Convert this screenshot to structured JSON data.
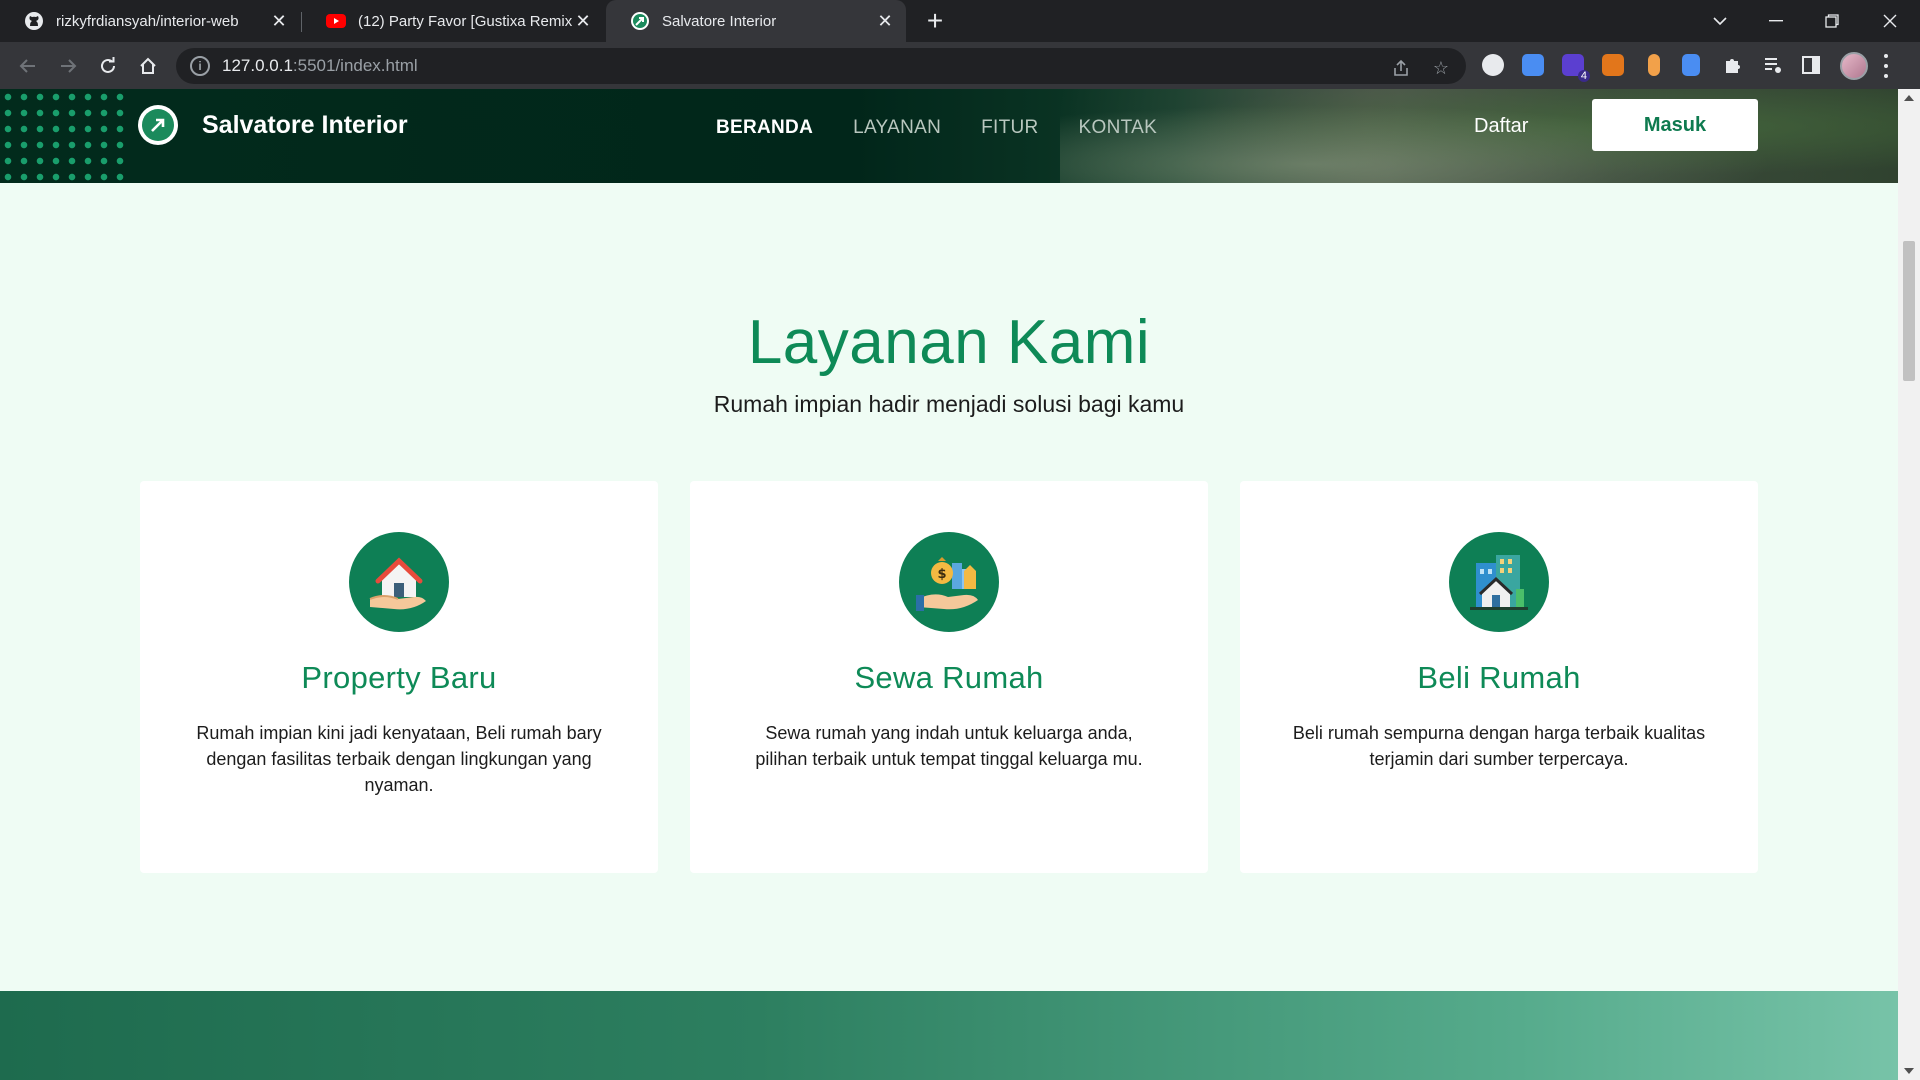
{
  "browser": {
    "tabs": [
      {
        "title": "rizkyfrdiansyah/interior-web",
        "icon": "github-icon",
        "active": false
      },
      {
        "title": "(12) Party Favor [Gustixa Remix] ",
        "icon": "youtube-icon",
        "active": false
      },
      {
        "title": "Salvatore Interior",
        "icon": "site-favicon",
        "active": true
      }
    ],
    "url_host": "127.0.0.1",
    "url_rest": ":5501/index.html",
    "extension_badge": "4"
  },
  "site": {
    "brand": "Salvatore Interior",
    "nav": [
      "BERANDA",
      "LAYANAN",
      "FITUR",
      "KONTAK"
    ],
    "nav_active": "BERANDA",
    "register": "Daftar",
    "login": "Masuk"
  },
  "services": {
    "title": "Layanan Kami",
    "subtitle": "Rumah impian hadir menjadi solusi bagi kamu",
    "cards": [
      {
        "title": "Property Baru",
        "text": "Rumah impian kini jadi kenyataan, Beli rumah bary dengan fasilitas terbaik dengan lingkungan yang nyaman.",
        "icon": "house-in-hand-icon"
      },
      {
        "title": "Sewa Rumah",
        "text": "Sewa rumah yang indah untuk keluarga anda, pilihan terbaik untuk tempat tinggal keluarga mu.",
        "icon": "money-property-icon"
      },
      {
        "title": "Beli Rumah",
        "text": "Beli rumah sempurna dengan harga terbaik kualitas terjamin dari sumber terpercaya.",
        "icon": "buildings-icon"
      }
    ]
  },
  "colors": {
    "accent": "#0e8a57",
    "page_bg": "#effcf4",
    "header_bg": "#022b1c"
  }
}
